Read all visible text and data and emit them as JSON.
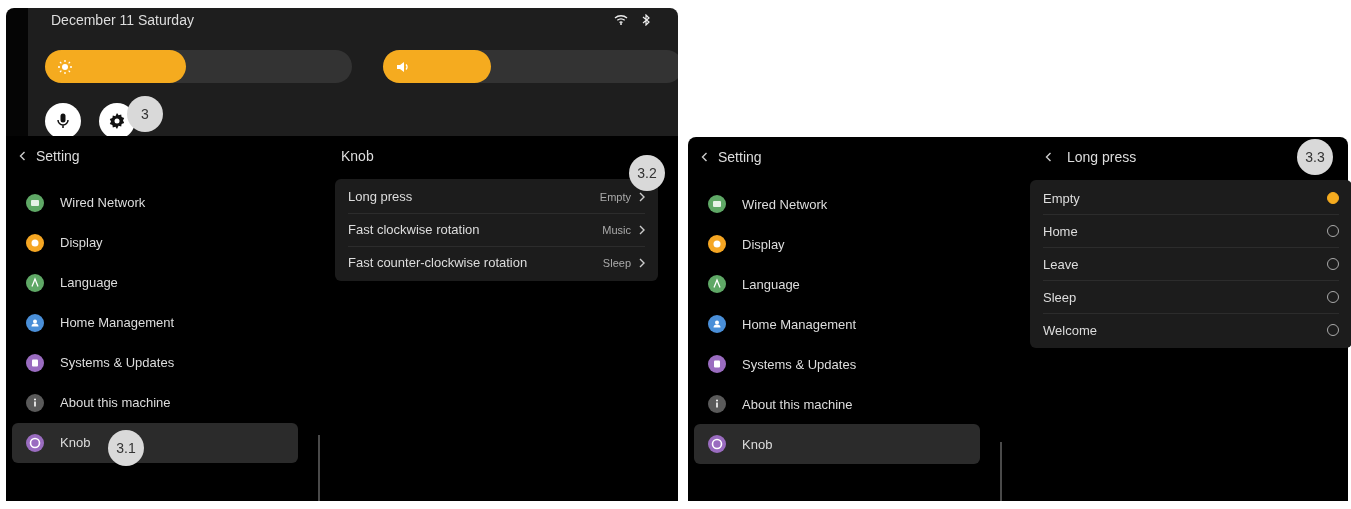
{
  "control_center": {
    "date": "December 11  Saturday",
    "brightness": {
      "level": 0.46
    },
    "volume": {
      "level": 0.36
    },
    "annotation": "3"
  },
  "screens": [
    {
      "back_label": "Setting",
      "sidebar": [
        {
          "label": "Wired Network",
          "color": "#5fa866",
          "selected": false
        },
        {
          "label": "Display",
          "color": "#f5a623",
          "selected": false
        },
        {
          "label": "Language",
          "color": "#5fa866",
          "selected": false
        },
        {
          "label": "Home Management",
          "color": "#4a8fd8",
          "selected": false
        },
        {
          "label": "Systems & Updates",
          "color": "#9a6cc0",
          "selected": false
        },
        {
          "label": "About this machine",
          "color": "#5a5a5a",
          "selected": false
        },
        {
          "label": "Knob",
          "color": "#9a6cc0",
          "selected": true,
          "annotation": "3.1"
        }
      ],
      "detail": {
        "kind": "menu",
        "title": "Knob",
        "annotation": "3.2",
        "rows": [
          {
            "label": "Long press",
            "value": "Empty"
          },
          {
            "label": "Fast clockwise rotation",
            "value": "Music"
          },
          {
            "label": "Fast counter-clockwise rotation",
            "value": "Sleep"
          }
        ]
      }
    },
    {
      "back_label": "Setting",
      "sidebar": [
        {
          "label": "Wired Network",
          "color": "#5fa866",
          "selected": false
        },
        {
          "label": "Display",
          "color": "#f5a623",
          "selected": false
        },
        {
          "label": "Language",
          "color": "#5fa866",
          "selected": false
        },
        {
          "label": "Home Management",
          "color": "#4a8fd8",
          "selected": false
        },
        {
          "label": "Systems & Updates",
          "color": "#9a6cc0",
          "selected": false
        },
        {
          "label": "About this machine",
          "color": "#5a5a5a",
          "selected": false
        },
        {
          "label": "Knob",
          "color": "#9a6cc0",
          "selected": true
        }
      ],
      "detail": {
        "kind": "options",
        "title": "Long press",
        "annotation": "3.3",
        "options": [
          {
            "label": "Empty",
            "selected": true
          },
          {
            "label": "Home",
            "selected": false
          },
          {
            "label": "Leave",
            "selected": false
          },
          {
            "label": "Sleep",
            "selected": false
          },
          {
            "label": "Welcome",
            "selected": false
          }
        ]
      }
    }
  ]
}
